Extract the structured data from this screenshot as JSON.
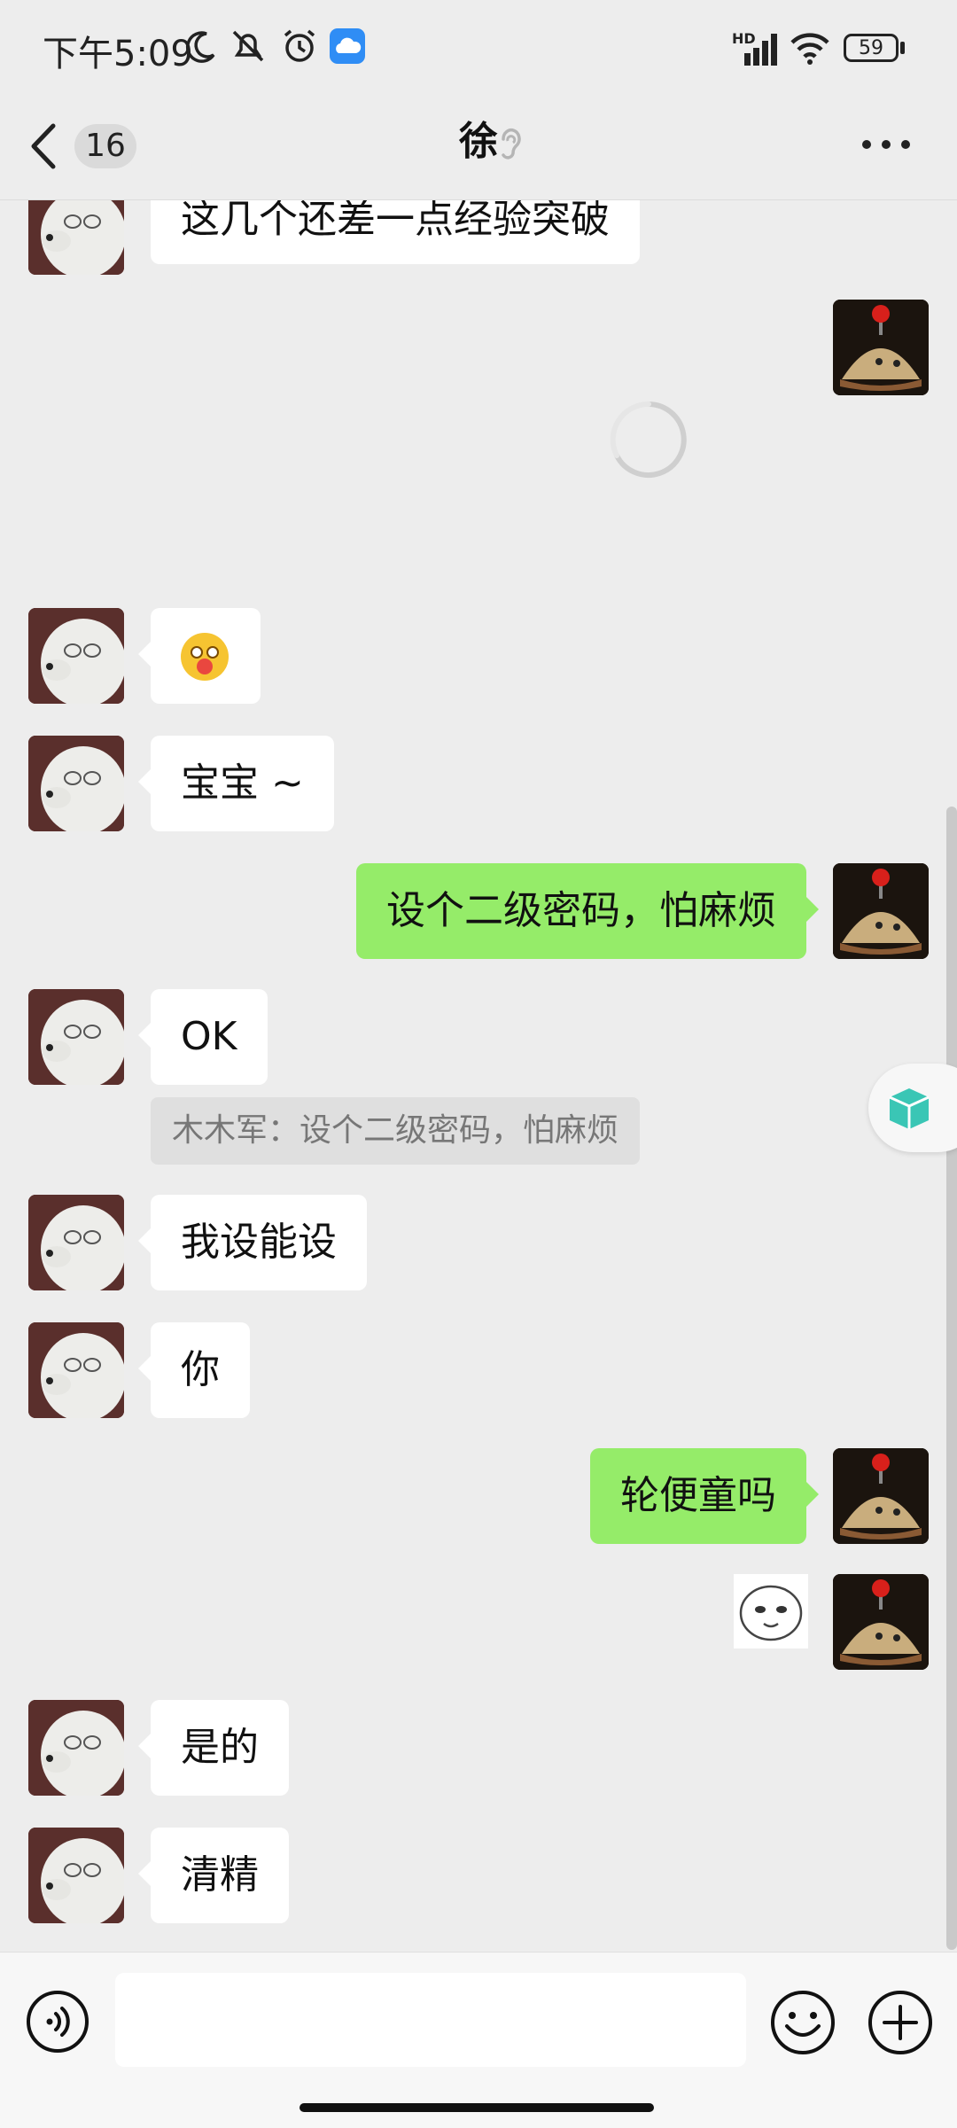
{
  "status_bar": {
    "time": "下午5:09",
    "battery": "59",
    "network_label": "HD"
  },
  "nav": {
    "unread_count": "16",
    "title": "徐"
  },
  "messages": [
    {
      "text": "这几个还差一点经验突破"
    },
    {
      "text": "宝宝 ~"
    },
    {
      "text": "设个二级密码，怕麻烦"
    },
    {
      "text": "OK"
    },
    {
      "text": "我设能设"
    },
    {
      "text": "你"
    },
    {
      "text": "轮便童吗"
    },
    {
      "text": "是的"
    },
    {
      "text": "清精"
    }
  ],
  "quote": {
    "text": "木木军：设个二级密码，怕麻烦"
  },
  "input": {
    "placeholder": ""
  },
  "colors": {
    "background": "#ededed",
    "bubble_self": "#95ec69",
    "bubble_other": "#ffffff",
    "accent_teal": "#3ac6b5"
  },
  "icons": [
    "voice-icon",
    "emoji-icon",
    "plus-icon",
    "back-icon",
    "more-icon",
    "ear-icon",
    "loading-spinner-icon"
  ]
}
